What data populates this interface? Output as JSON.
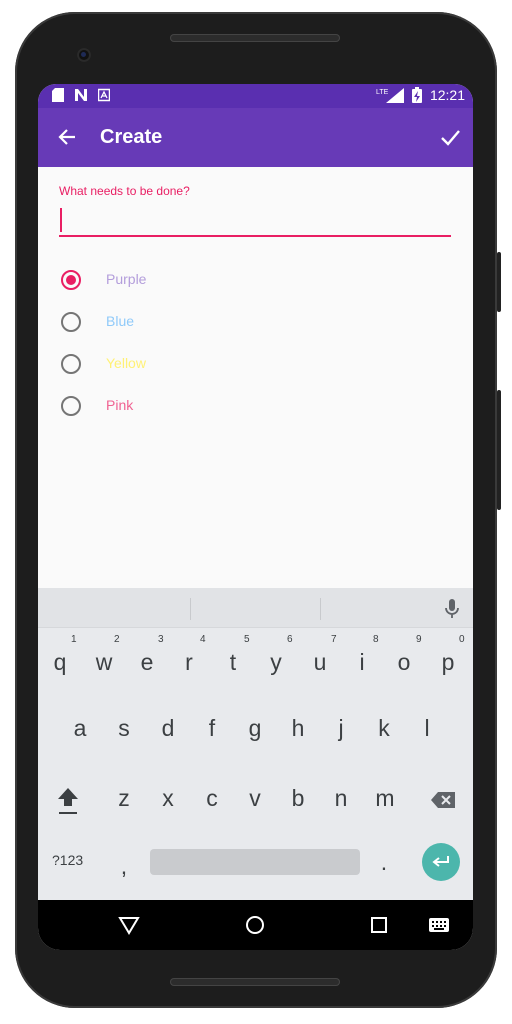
{
  "status_bar": {
    "time": "12:21",
    "left_icons": [
      "sd-card-icon",
      "n-icon",
      "a-icon"
    ],
    "right_icons": [
      "lte-signal-icon",
      "battery-charging-icon"
    ],
    "network_label": "LTE"
  },
  "app_bar": {
    "title": "Create",
    "back_icon": "arrow-back-icon",
    "confirm_icon": "check-icon",
    "color": "#673ab7"
  },
  "form": {
    "field_label": "What needs to be done?",
    "field_value": "",
    "accent_color": "#e91e63"
  },
  "color_options": [
    {
      "label": "Purple",
      "color": "#b39ddb",
      "selected": true
    },
    {
      "label": "Blue",
      "color": "#90caf9",
      "selected": false
    },
    {
      "label": "Yellow",
      "color": "#fff176",
      "selected": false
    },
    {
      "label": "Pink",
      "color": "#f06292",
      "selected": false
    }
  ],
  "keyboard": {
    "row1": [
      "q",
      "w",
      "e",
      "r",
      "t",
      "y",
      "u",
      "i",
      "o",
      "p"
    ],
    "row1_hints": [
      "1",
      "2",
      "3",
      "4",
      "5",
      "6",
      "7",
      "8",
      "9",
      "0"
    ],
    "row2": [
      "a",
      "s",
      "d",
      "f",
      "g",
      "h",
      "j",
      "k",
      "l"
    ],
    "row3": [
      "z",
      "x",
      "c",
      "v",
      "b",
      "n",
      "m"
    ],
    "symbols_label": "?123",
    "comma": ",",
    "period": ".",
    "enter_color": "#4cb6ac"
  },
  "nav_bar": {
    "items": [
      "back-triangle-icon",
      "home-circle-icon",
      "recents-square-icon",
      "keyboard-switch-icon"
    ]
  }
}
